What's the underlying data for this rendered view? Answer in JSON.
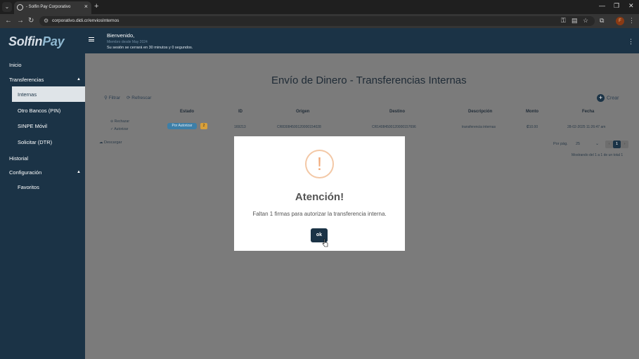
{
  "browser": {
    "tab_title": "- Solfin Pay Corporativo",
    "url": "corporativo.didi.cr/enviosInternos",
    "profile_initial": "F"
  },
  "header": {
    "brand_main": "Solfin",
    "brand_accent": "Pay",
    "welcome": "Bienvenido,",
    "member_since": "Miembro desde May 2024",
    "session_notice": "Su sesión se cerrará en 30 minutos y 0 segundos."
  },
  "sidebar": {
    "items": [
      {
        "label": "Inicio"
      },
      {
        "label": "Transferencias"
      },
      {
        "label": "Internas"
      },
      {
        "label": "Otro Bancos (PIN)"
      },
      {
        "label": "SINPE Móvil"
      },
      {
        "label": "Solicitar (DTR)"
      },
      {
        "label": "Historial"
      },
      {
        "label": "Configuración"
      },
      {
        "label": "Favoritos"
      }
    ]
  },
  "main": {
    "title": "Envío de Dinero - Transferencias Internas",
    "filter_label": "Filtrar",
    "refresh_label": "Refrescar",
    "create_label": "Crear",
    "columns": [
      "Estado",
      "ID",
      "Origen",
      "Destino",
      "Descripción",
      "Monto",
      "Fecha"
    ],
    "row": {
      "reject_label": "Rechazar",
      "authorize_label": "Autorizar",
      "status": "Por Autorizar",
      "status_count": "2",
      "id": "169213",
      "origin": "CR83084500120000154028",
      "destination": "CR14084500120000157696",
      "description": "transferencia internas",
      "amount": "₡10.00",
      "date": "28-02-2025 11:26:47 am"
    },
    "download_label": "Descargar",
    "per_page_label": "Por pág.",
    "per_page_value": "25",
    "current_page": "1",
    "showing_text": "Mostrando del 1 a 1 de un total 1"
  },
  "modal": {
    "icon_glyph": "!",
    "title": "Atención!",
    "message": "Faltan 1 firmas para autorizar la transferencia interna.",
    "ok_label": "ok"
  },
  "colors": {
    "primary": "#1b3346",
    "overlay_main": "#7b7b7b",
    "warning_icon": "#f1a978",
    "status_badge": "#3d7fa8",
    "count_badge": "#d9a03a"
  }
}
